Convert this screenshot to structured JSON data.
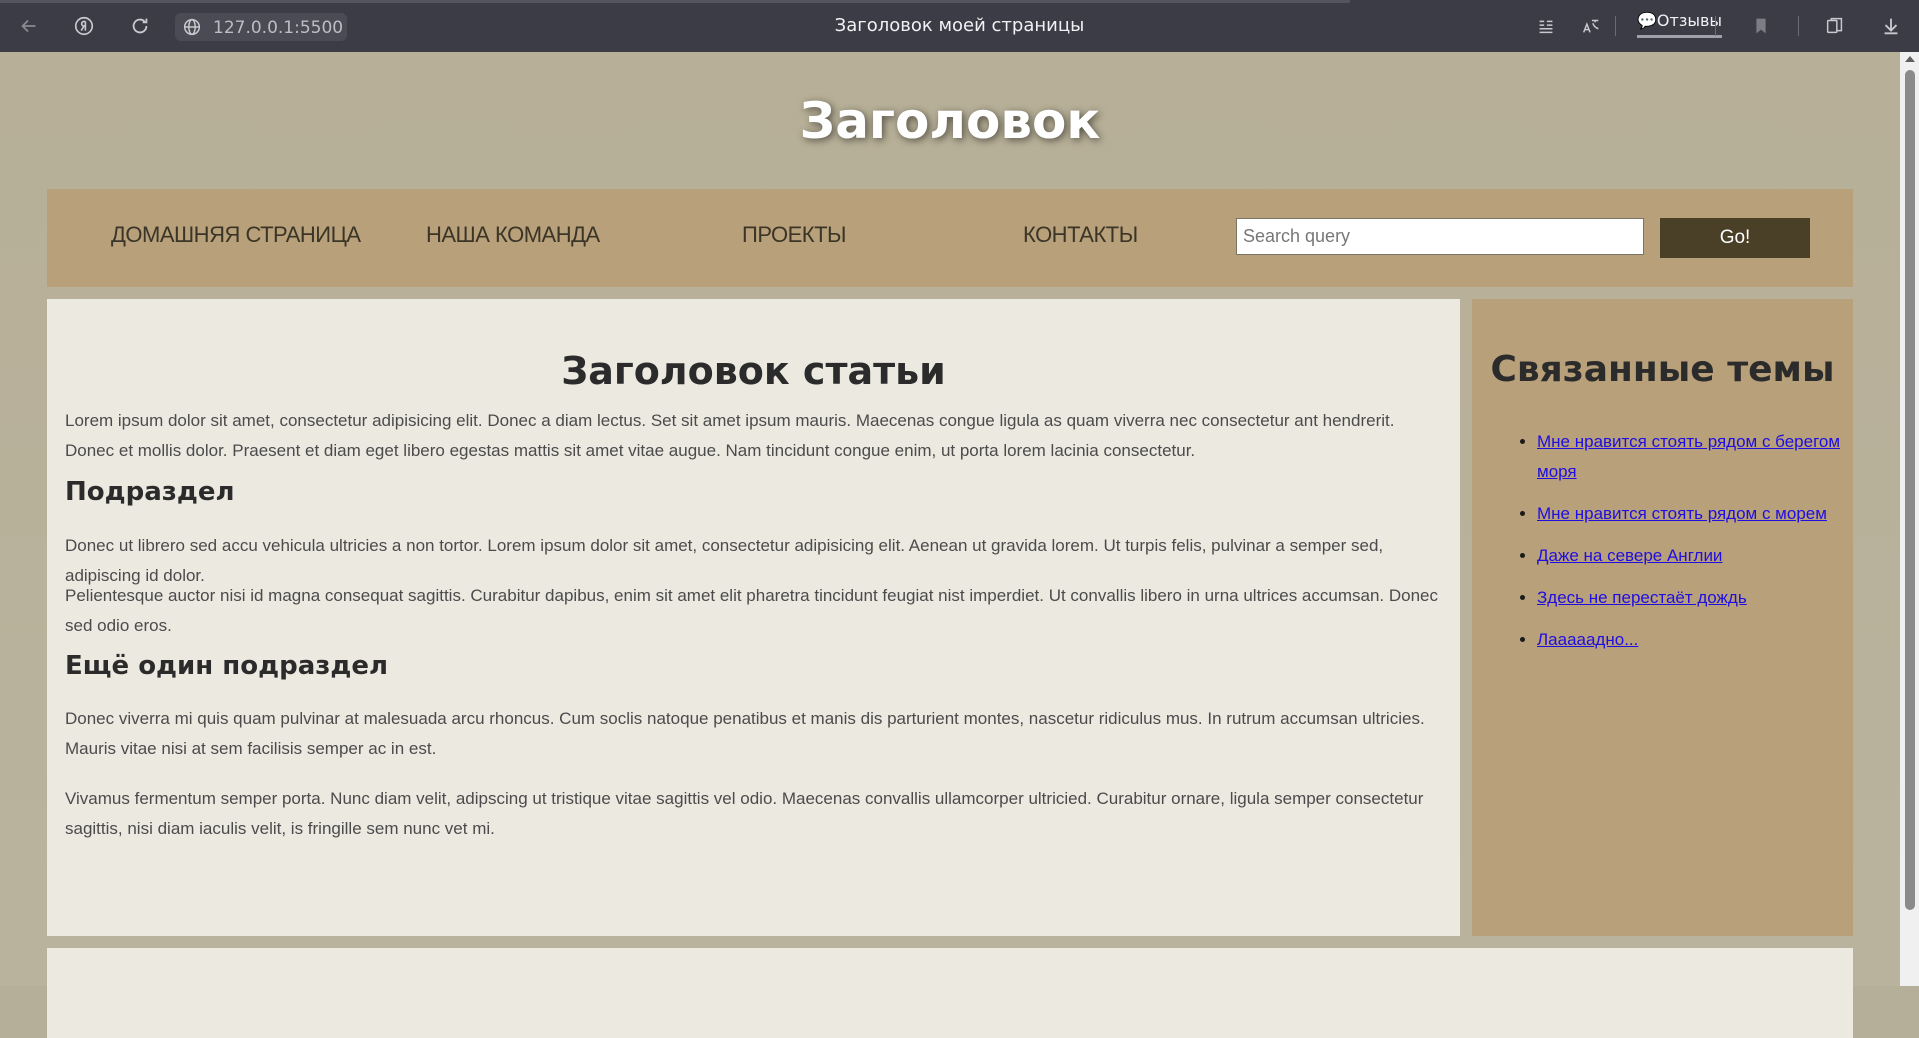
{
  "browser": {
    "url": "127.0.0.1:5500",
    "tab_title": "Заголовок моей страницы",
    "feedback_label": "Отзывы"
  },
  "header": {
    "site_title": "Заголовок"
  },
  "nav": {
    "items": [
      "ДОМАШНЯЯ СТРАНИЦА",
      "НАША КОМАНДА",
      "ПРОЕКТЫ",
      "КОНТАКТЫ"
    ],
    "search_placeholder": "Search query",
    "go_label": "Go!"
  },
  "article": {
    "title": "Заголовок статьи",
    "intro": "Lorem ipsum dolor sit amet, consectetur adipisicing elit. Donec a diam lectus. Set sit amet ipsum mauris. Maecenas congue ligula as quam viverra nec consectetur ant hendrerit. Donec et mollis dolor. Praesent et diam eget libero egestas mattis sit amet vitae augue. Nam tincidunt congue enim, ut porta lorem lacinia consectetur.",
    "sub1_title": "Подраздел",
    "sub1_p1": "Donec ut librero sed accu vehicula ultricies a non tortor. Lorem ipsum dolor sit amet, consectetur adipisicing elit. Aenean ut gravida lorem. Ut turpis felis, pulvinar a semper sed, adipiscing id dolor.",
    "sub1_p2": "Pelientesque auctor nisi id magna consequat sagittis. Curabitur dapibus, enim sit amet elit pharetra tincidunt feugiat nist imperdiet. Ut convallis libero in urna ultrices accumsan. Donec sed odio eros.",
    "sub2_title": "Ещё один подраздел",
    "sub2_p1": "Donec viverra mi quis quam pulvinar at malesuada arcu rhoncus. Cum soclis natoque penatibus et manis dis parturient montes, nascetur ridiculus mus. In rutrum accumsan ultricies. Mauris vitae nisi at sem facilisis semper ac in est.",
    "sub2_p2": "Vivamus fermentum semper porta. Nunc diam velit, adipscing ut tristique vitae sagittis vel odio. Maecenas convallis ullamcorper ultricied. Curabitur ornare, ligula semper consectetur sagittis, nisi diam iaculis velit, is fringille sem nunc vet mi."
  },
  "aside": {
    "title": "Связанные темы",
    "links": [
      "Мне нравится стоять рядом с берегом моря",
      "Мне нравится стоять рядом с морем",
      "Даже на севере Англии",
      "Здесь не перестаёт дождь",
      "Лааааадно..."
    ]
  },
  "colors": {
    "background": "#b7af97",
    "nav_bg": "#b8a07a",
    "content_bg": "#ece9e1",
    "button_bg": "#4a3f27",
    "link": "#1f0ee0"
  }
}
